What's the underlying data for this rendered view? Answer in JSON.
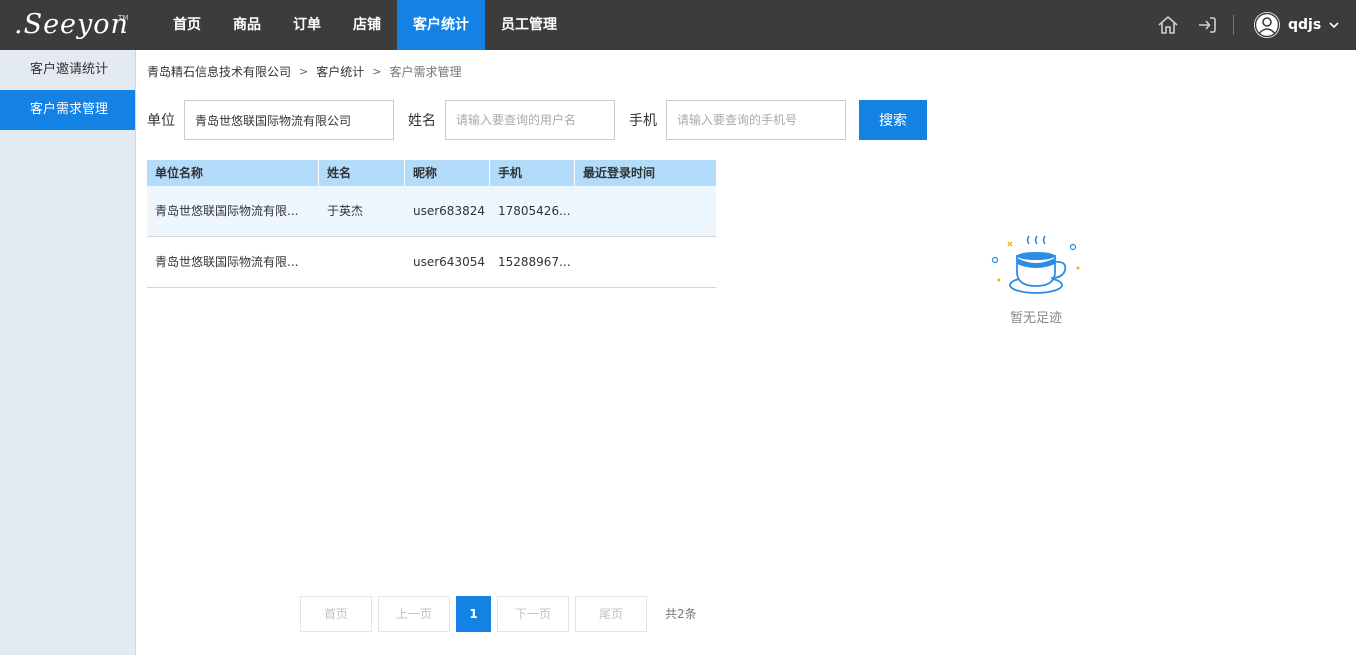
{
  "logo": {
    "text": ".Seeyon",
    "tm": "TM"
  },
  "nav": [
    {
      "label": "首页",
      "active": false
    },
    {
      "label": "商品",
      "active": false
    },
    {
      "label": "订单",
      "active": false
    },
    {
      "label": "店铺",
      "active": false
    },
    {
      "label": "客户统计",
      "active": true
    },
    {
      "label": "员工管理",
      "active": false
    }
  ],
  "user": {
    "name": "qdjs"
  },
  "sidebar": {
    "items": [
      {
        "label": "客户邀请统计",
        "active": false
      },
      {
        "label": "客户需求管理",
        "active": true
      }
    ]
  },
  "breadcrumb": {
    "company": "青岛精石信息技术有限公司",
    "section": "客户统计",
    "current": "客户需求管理",
    "separator": ">"
  },
  "filters": {
    "unit_label": "单位",
    "unit_value": "青岛世悠联国际物流有限公司",
    "name_label": "姓名",
    "name_placeholder": "请输入要查询的用户名",
    "phone_label": "手机",
    "phone_placeholder": "请输入要查询的手机号",
    "search_label": "搜索"
  },
  "table": {
    "columns": [
      "单位名称",
      "姓名",
      "昵称",
      "手机",
      "最近登录时间"
    ],
    "rows": [
      [
        "青岛世悠联国际物流有限...",
        "于英杰",
        "user683824",
        "17805426...",
        ""
      ],
      [
        "青岛世悠联国际物流有限...",
        "",
        "user643054",
        "15288967...",
        ""
      ]
    ]
  },
  "empty_state": {
    "text": "暂无足迹",
    "icon": "coffee-cup-icon"
  },
  "pagination": {
    "first": "首页",
    "prev": "上一页",
    "current": "1",
    "next": "下一页",
    "last": "尾页",
    "total": "共2条"
  },
  "colors": {
    "accent": "#1481e4",
    "topbar": "#3c3c3c",
    "sidebar": "#e4eaf1",
    "table_header": "#b3dcfb"
  }
}
